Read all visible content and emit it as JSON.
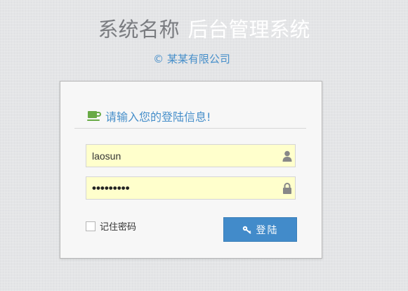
{
  "header": {
    "system_name": "系统名称",
    "subtitle": "后台管理系统",
    "copyright": "© 某某有限公司"
  },
  "login": {
    "heading": "请输入您的登陆信息!",
    "username_value": "laosun",
    "password_value": "123456789",
    "remember_label": "记住密码",
    "remember_checked": false,
    "submit_label": "登陆"
  },
  "icons": {
    "heading_icon": "coffee-icon",
    "username_icon": "user-icon",
    "password_icon": "lock-icon",
    "submit_icon": "key-icon"
  },
  "colors": {
    "accent": "#478fca",
    "button": "#428bca",
    "field_bg": "#ffffcc",
    "icon_green": "#69aa46",
    "title_gray": "#7a7c80"
  }
}
